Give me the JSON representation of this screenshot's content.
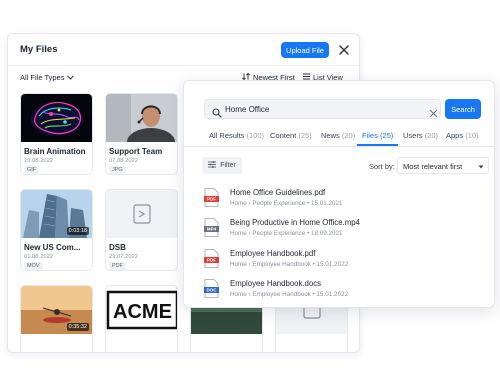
{
  "files_panel": {
    "title": "My Files",
    "upload_label": "Upload File",
    "filter_label": "All File Types",
    "sort_label": "Newest First",
    "view_label": "List View",
    "cards": [
      {
        "name": "Brain Animation",
        "date": "10.08.2022",
        "type": "GIF",
        "duration": ""
      },
      {
        "name": "Support Team",
        "date": "07.08.2022",
        "type": "JPG",
        "duration": ""
      },
      {
        "name": "New US Com...",
        "date": "01.08.2022",
        "type": "MOV",
        "duration": "0:03:18"
      },
      {
        "name": "DSB",
        "date": "29.07.2022",
        "type": "PDF",
        "duration": ""
      },
      {
        "name": "",
        "date": "",
        "type": "",
        "duration": "0:35:32"
      },
      {
        "name": "",
        "date": "",
        "type": "",
        "duration": ""
      },
      {
        "name": "",
        "date": "",
        "type": "",
        "duration": ""
      },
      {
        "name": "",
        "date": "",
        "type": "",
        "duration": ""
      }
    ],
    "acme_logo_text": "ACME"
  },
  "search_panel": {
    "query": "Home Office",
    "search_label": "Search",
    "tabs": [
      {
        "label": "All Results",
        "count": "(100)"
      },
      {
        "label": "Content",
        "count": "(25)"
      },
      {
        "label": "News",
        "count": "(20)"
      },
      {
        "label": "Files",
        "count": "(25)"
      },
      {
        "label": "Users",
        "count": "(20)"
      },
      {
        "label": "Apps",
        "count": "(10)"
      }
    ],
    "active_tab": "Files",
    "filter_label": "Filter",
    "sortby_label": "Sort by:",
    "sort_value": "Most relevant first",
    "results": [
      {
        "title": "Home Office Guidelines.pdf",
        "meta": "Home  ›  People Experience  •  15.01.2021",
        "icon": "pdf-icon",
        "icon_text": "PDF"
      },
      {
        "title": "Being Productive in Home Office.mp4",
        "meta": "Home  ›  People Experience  •  18.09.2021",
        "icon": "mp4-icon",
        "icon_text": "MP4"
      },
      {
        "title": "Employee Handbook.pdf",
        "meta": "Home  ›  Employee Handbook  •  15.01.2022",
        "icon": "pdf-icon",
        "icon_text": "PDF"
      },
      {
        "title": "Employee Handbook.docs",
        "meta": "Home  ›  Employee Handbook  •  15.01.2022",
        "icon": "doc-icon",
        "icon_text": "DOC"
      }
    ]
  },
  "colors": {
    "accent": "#1877f2",
    "pdf": "#e2403b",
    "doc": "#2f66c9",
    "mp4": "#6b7280"
  }
}
